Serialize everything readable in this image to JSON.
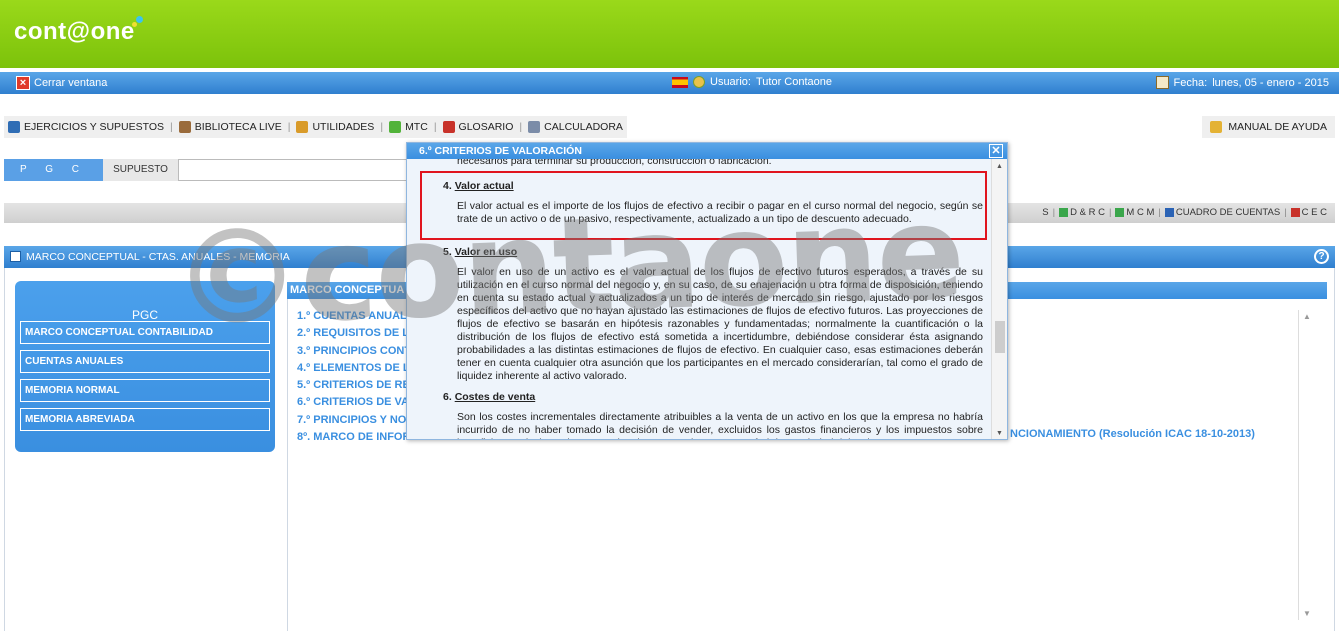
{
  "header": {
    "logo": "cont@one"
  },
  "bluebar": {
    "close_label": "Cerrar ventana",
    "user_label": "Usuario:",
    "user_name": "Tutor Contaone",
    "date_label": "Fecha:",
    "date_value": "lunes, 05 - enero - 2015"
  },
  "menu": {
    "items": [
      "EJERCICIOS Y SUPUESTOS",
      "BIBLIOTECA LIVE",
      "UTILIDADES",
      "MTC",
      "GLOSARIO",
      "CALCULADORA"
    ],
    "help": "MANUAL DE AYUDA"
  },
  "pgc_row": {
    "tab": "P G C",
    "supuesto": "SUPUESTO",
    "input_value": ""
  },
  "toolbar2": {
    "links": [
      "S",
      "D & R C",
      "M C M",
      "CUADRO DE CUENTAS",
      "C E C"
    ]
  },
  "panel": {
    "title": "MARCO CONCEPTUAL - CTAS. ANUALES - MEMORIA"
  },
  "sidenav": {
    "title": "PGC",
    "items": [
      "MARCO CONCEPTUAL CONTABILIDAD",
      "CUENTAS ANUALES",
      "MEMORIA NORMAL",
      "MEMORIA ABREVIADA"
    ]
  },
  "content": {
    "header": "MARCO CONCEPTUA",
    "list": [
      "1.º CUENTAS ANUAL",
      "2.º REQUISITOS DE L",
      "3.º PRINCIPIOS CONT",
      "4.º ELEMENTOS DE L",
      "5.º CRITERIOS DE RE",
      "6.º CRITERIOS DE VA",
      "7.º PRINCIPIOS Y NO",
      "8º. MARCO DE INFOR"
    ],
    "item8_tail": "NCIONAMIENTO (Resolución ICAC 18-10-2013)"
  },
  "watermark": "©contaone",
  "popup": {
    "title": "6.º CRITERIOS DE VALORACIÓN",
    "fragment": "necesarios para terminar su producción, construcción o fabricación.",
    "sections": [
      {
        "num": "4.",
        "title": "Valor actual",
        "text": "El valor actual es el importe de los flujos de efectivo a recibir o pagar en el curso normal del negocio, según se trate de un activo o de un pasivo, respectivamente, actualizado a un tipo de descuento adecuado."
      },
      {
        "num": "5.",
        "title": "Valor en uso",
        "text": "El valor en uso de un activo es el valor actual de los flujos de efectivo futuros esperados, a través de su utilización en el curso normal del negocio y, en su caso, de su enajenación u otra forma de disposición, teniendo en cuenta su estado actual y actualizados a un tipo de interés de mercado sin riesgo, ajustado por los riesgos específicos del activo que no hayan ajustado las estimaciones de flujos de efectivo futuros. Las proyecciones de flujos de efectivo se basarán en hipótesis razonables y fundamentadas; normalmente la cuantificación o la distribución de los flujos de efectivo está sometida a incertidumbre, debiéndose considerar ésta asignando probabilidades a las distintas estimaciones de flujos de efectivo. En cualquier caso, esas estimaciones deberán tener en cuenta cualquier otra asunción que los participantes en el mercado considerarían, tal como el grado de liquidez inherente al activo valorado."
      },
      {
        "num": "6.",
        "title": "Costes de venta",
        "text": "Son los costes incrementales directamente atribuibles a la venta de un activo en los que la empresa no habría incurrido de no haber tomado la decisión de vender, excluidos los gastos financieros y los impuestos sobre beneficios. Se incluyen los gastos legales necesarios para transferir la propiedad del activo."
      }
    ]
  },
  "colors": {
    "green": "#8dce10",
    "blue": "#3a8fe0",
    "highlight": "#e0141e"
  }
}
